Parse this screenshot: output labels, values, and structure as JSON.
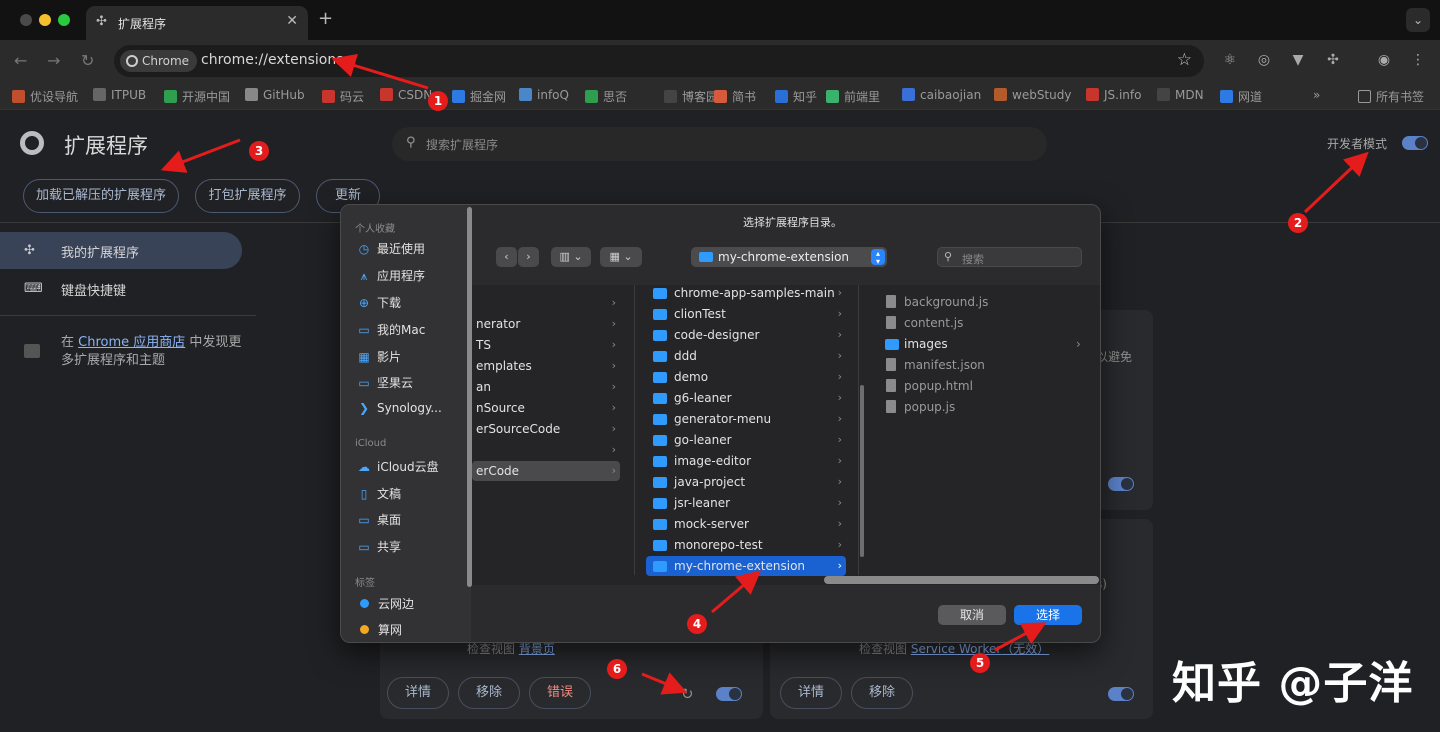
{
  "browser": {
    "tab_title": "扩展程序",
    "tab_close": "✕",
    "new_tab": "+",
    "tab_menu": "⌄",
    "chip_label": "Chrome",
    "url": "chrome://extensions",
    "bookmarks": [
      {
        "label": "优设导航",
        "color": "#c0502d"
      },
      {
        "label": "ITPUB",
        "color": "#666"
      },
      {
        "label": "开源中国",
        "color": "#2e9e4f"
      },
      {
        "label": "GitHub",
        "color": "#888"
      },
      {
        "label": "码云",
        "color": "#c7352d"
      },
      {
        "label": "CSDN",
        "color": "#c7352d"
      },
      {
        "label": "掘金网",
        "color": "#2d7ae5"
      },
      {
        "label": "infoQ",
        "color": "#4a86c8"
      },
      {
        "label": "思否",
        "color": "#2e9e4f"
      },
      {
        "label": "博客园",
        "color": "#444"
      },
      {
        "label": "简书",
        "color": "#d65a3b"
      },
      {
        "label": "知乎",
        "color": "#2a6fd6"
      },
      {
        "label": "前端里",
        "color": "#3bb26b"
      },
      {
        "label": "caibaojian",
        "color": "#3a6fd8"
      },
      {
        "label": "webStudy",
        "color": "#b35b2a"
      },
      {
        "label": "JS.info",
        "color": "#c7352d"
      },
      {
        "label": "MDN",
        "color": "#444"
      },
      {
        "label": "网道",
        "color": "#2d7ae5"
      }
    ],
    "bookmarks_more": "»",
    "all_bookmarks": "所有书签"
  },
  "extensions_page": {
    "title": "扩展程序",
    "search_placeholder": "搜索扩展程序",
    "dev_mode_label": "开发者模式",
    "dev_mode_on": true,
    "buttons": [
      "加载已解压的扩展程序",
      "打包扩展程序",
      "更新"
    ],
    "sidebar": [
      {
        "label": "我的扩展程序",
        "active": true
      },
      {
        "label": "键盘快捷键",
        "active": false
      }
    ],
    "store_text_prefix": "在 ",
    "store_link": "Chrome 应用商店",
    "store_text_suffix": " 中发现更多扩展程序和主题",
    "card_fragments": {
      "right_top": "以避免",
      "right_mid": "s)"
    },
    "card_left": {
      "inspect_label": "检查视图",
      "inspect_link": "背景页",
      "buttons": [
        "详情",
        "移除",
        "错误"
      ]
    },
    "card_right": {
      "inspect_label": "检查视图",
      "inspect_link": "Service Worker",
      "inspect_suffix": "（无效）",
      "buttons": [
        "详情",
        "移除"
      ]
    }
  },
  "dialog": {
    "title": "选择扩展程序目录。",
    "path": "my-chrome-extension",
    "search_placeholder": "搜索",
    "sidebar": {
      "favorites_heading": "个人收藏",
      "favorites": [
        {
          "label": "最近使用",
          "icon": "clock-icon",
          "glyph": "◷"
        },
        {
          "label": "应用程序",
          "icon": "apps-icon",
          "glyph": "⩚"
        },
        {
          "label": "下载",
          "icon": "download-icon",
          "glyph": "⊕"
        },
        {
          "label": "我的Mac",
          "icon": "folder-icon",
          "glyph": "▭"
        },
        {
          "label": "影片",
          "icon": "film-icon",
          "glyph": "▦"
        },
        {
          "label": "坚果云",
          "icon": "folder-icon",
          "glyph": "▭"
        },
        {
          "label": "Synology...",
          "icon": "synology-icon",
          "glyph": "❯"
        }
      ],
      "icloud_heading": "iCloud",
      "icloud": [
        {
          "label": "iCloud云盘",
          "icon": "cloud-icon",
          "glyph": "☁"
        },
        {
          "label": "文稿",
          "icon": "document-icon",
          "glyph": "▯"
        },
        {
          "label": "桌面",
          "icon": "desktop-icon",
          "glyph": "▭"
        },
        {
          "label": "共享",
          "icon": "shared-folder-icon",
          "glyph": "▭"
        }
      ],
      "tags_heading": "标签",
      "tags": [
        {
          "label": "云网边",
          "color": "#2f9bff"
        },
        {
          "label": "算网",
          "color": "#f5a623"
        }
      ]
    },
    "column1": [
      {
        "label": "",
        "selected": false
      },
      {
        "label": "nerator",
        "selected": false
      },
      {
        "label": "TS",
        "selected": false
      },
      {
        "label": "emplates",
        "selected": false
      },
      {
        "label": "an",
        "selected": false
      },
      {
        "label": "nSource",
        "selected": false
      },
      {
        "label": "erSourceCode",
        "selected": false
      },
      {
        "label": "",
        "selected": false
      },
      {
        "label": "erCode",
        "selected": true
      }
    ],
    "column2": [
      "chrome-app-samples-main",
      "clionTest",
      "code-designer",
      "ddd",
      "demo",
      "g6-leaner",
      "generator-menu",
      "go-leaner",
      "image-editor",
      "java-project",
      "jsr-leaner",
      "mock-server",
      "monorepo-test",
      "my-chrome-extension"
    ],
    "column2_selected": "my-chrome-extension",
    "column3": [
      {
        "label": "background.js",
        "type": "file"
      },
      {
        "label": "content.js",
        "type": "file"
      },
      {
        "label": "images",
        "type": "folder"
      },
      {
        "label": "manifest.json",
        "type": "file"
      },
      {
        "label": "popup.html",
        "type": "file"
      },
      {
        "label": "popup.js",
        "type": "file"
      }
    ],
    "cancel_label": "取消",
    "choose_label": "选择"
  },
  "annotations": [
    "1",
    "2",
    "3",
    "4",
    "5",
    "6"
  ],
  "watermark": "知乎 @子洋"
}
